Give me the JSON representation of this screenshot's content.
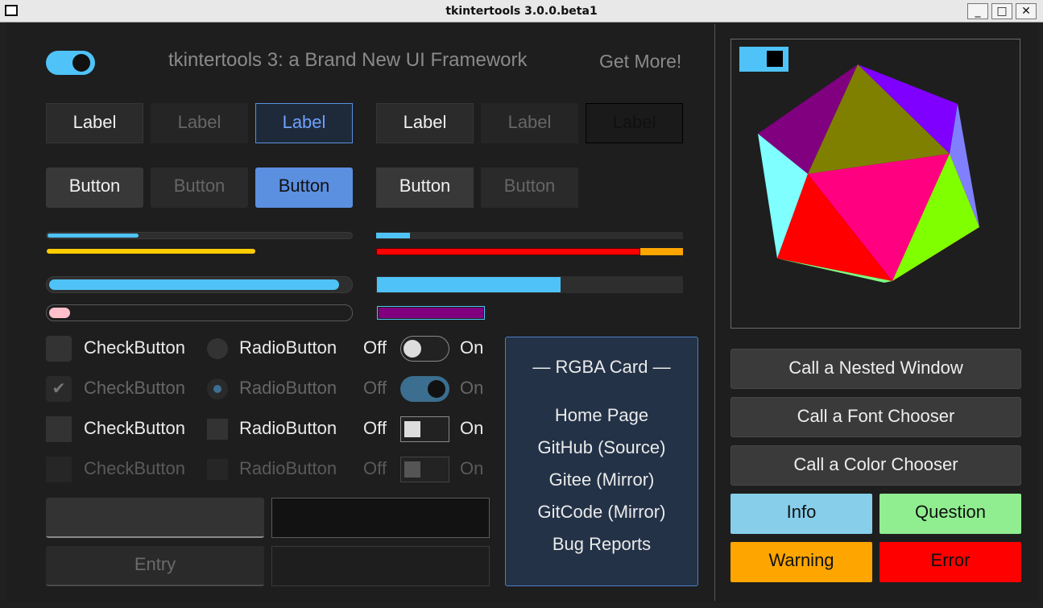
{
  "window": {
    "title": "tkintertools 3.0.0.beta1",
    "minimize": "_",
    "maximize": "□",
    "close": "✕"
  },
  "header": {
    "title": "tkintertools 3: a Brand New UI Framework",
    "link": "Get More!",
    "theme_toggle_on": true
  },
  "labels": [
    "Label",
    "Label",
    "Label",
    "Label",
    "Label",
    "Label"
  ],
  "buttons": [
    "Button",
    "Button",
    "Button",
    "Button",
    "Button"
  ],
  "progress": {
    "bar_1": 0.3,
    "bar_2": 0.68,
    "bar_3": 0.11,
    "bar_4_red": 0.86,
    "bar_5": 0.96,
    "bar_6": 0.6,
    "bar_7": 0.07,
    "bar_8": 1.0
  },
  "controls": {
    "check_label": "CheckButton",
    "radio_label": "RadioButton",
    "off_label": "Off",
    "on_label": "On",
    "checkmark": "✔"
  },
  "entries": {
    "entry_disabled_placeholder": "Entry"
  },
  "card": {
    "title": "— RGBA Card —",
    "links": [
      "Home Page",
      "GitHub (Source)",
      "Gitee (Mirror)",
      "GitCode (Mirror)",
      "Bug Reports"
    ]
  },
  "side": {
    "nested_window": "Call a Nested Window",
    "font_chooser": "Call a Font Chooser",
    "color_chooser": "Call a Color Chooser",
    "info": "Info",
    "question": "Question",
    "warning": "Warning",
    "error": "Error"
  },
  "colors": {
    "accent_blue": "#4fc3f7",
    "yellow": "#ffcc00",
    "red": "#ff0000",
    "orange": "#ffa500",
    "purple": "#800080",
    "pink": "#ffc0cb",
    "info": "#87ceeb",
    "question": "#90ee90",
    "warning": "#ffa500",
    "error": "#ff0000"
  }
}
